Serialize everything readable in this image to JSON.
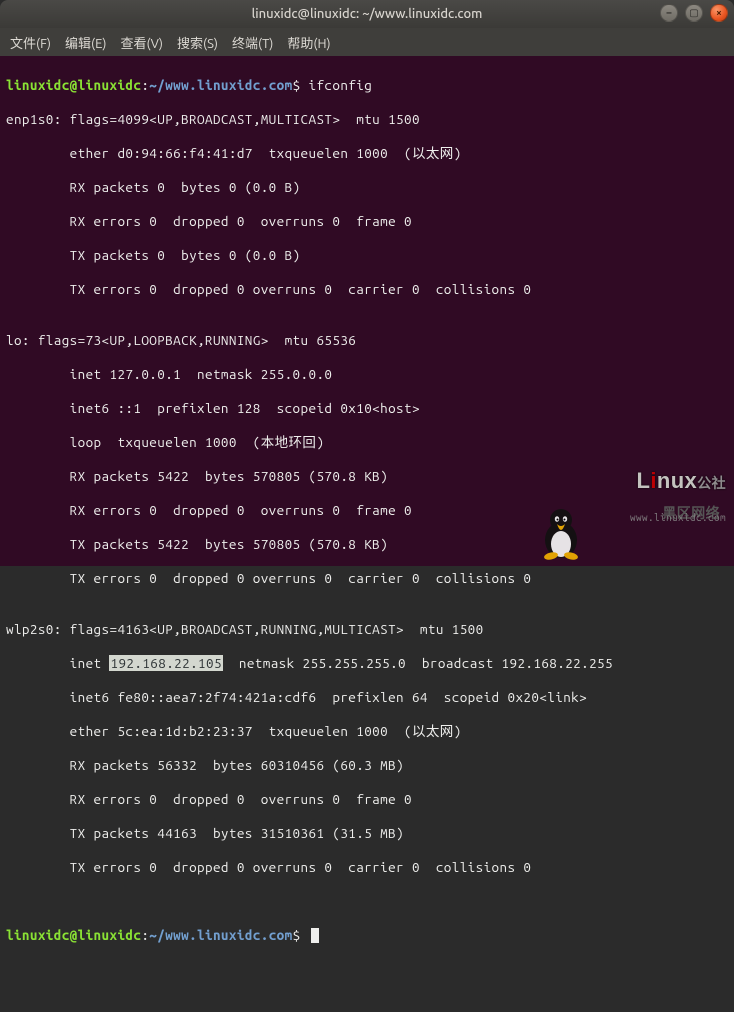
{
  "window": {
    "title": "linuxidc@linuxidc: ~/www.linuxidc.com"
  },
  "menu": {
    "file": "文件(F)",
    "edit": "编辑(E)",
    "view": "查看(V)",
    "search": "搜索(S)",
    "terminal": "终端(T)",
    "help": "帮助(H)"
  },
  "prompt": {
    "user": "linuxidc@linuxidc",
    "colon": ":",
    "path": "~/www.linuxidc.com",
    "dollar": "$"
  },
  "cmd1": "ifconfig",
  "out": {
    "l1": "enp1s0: flags=4099<UP,BROADCAST,MULTICAST>  mtu 1500",
    "l2": "        ether d0:94:66:f4:41:d7  txqueuelen 1000  (以太网)",
    "l3": "        RX packets 0  bytes 0 (0.0 B)",
    "l4": "        RX errors 0  dropped 0  overruns 0  frame 0",
    "l5": "        TX packets 0  bytes 0 (0.0 B)",
    "l6": "        TX errors 0  dropped 0 overruns 0  carrier 0  collisions 0",
    "blank1": "",
    "l7": "lo: flags=73<UP,LOOPBACK,RUNNING>  mtu 65536",
    "l8": "        inet 127.0.0.1  netmask 255.0.0.0",
    "l9": "        inet6 ::1  prefixlen 128  scopeid 0x10<host>",
    "l10": "        loop  txqueuelen 1000  (本地环回)",
    "l11": "        RX packets 5422  bytes 570805 (570.8 KB)",
    "l12": "        RX errors 0  dropped 0  overruns 0  frame 0",
    "l13": "        TX packets 5422  bytes 570805 (570.8 KB)",
    "l14": "        TX errors 0  dropped 0 overruns 0  carrier 0  collisions 0",
    "blank2": "",
    "l15": "wlp2s0: flags=4163<UP,BROADCAST,RUNNING,MULTICAST>  mtu 1500",
    "l16a": "        inet ",
    "l16hl": "192.168.22.105",
    "l16b": "  netmask 255.255.255.0  broadcast 192.168.22.255",
    "l17": "        inet6 fe80::aea7:2f74:421a:cdf6  prefixlen 64  scopeid 0x20<link>",
    "l18": "        ether 5c:ea:1d:b2:23:37  txqueuelen 1000  (以太网)",
    "l19": "        RX packets 56332  bytes 60310456 (60.3 MB)",
    "l20": "        RX errors 0  dropped 0  overruns 0  frame 0",
    "l21": "        TX packets 44163  bytes 31510361 (31.5 MB)",
    "l22": "        TX errors 0  dropped 0 overruns 0  carrier 0  collisions 0"
  },
  "watermark": {
    "top": "黑区网络",
    "main1": "L",
    "main2": "i",
    "main3": "nux",
    "suffix": "公社",
    "url": "www.linuxidc.com"
  }
}
